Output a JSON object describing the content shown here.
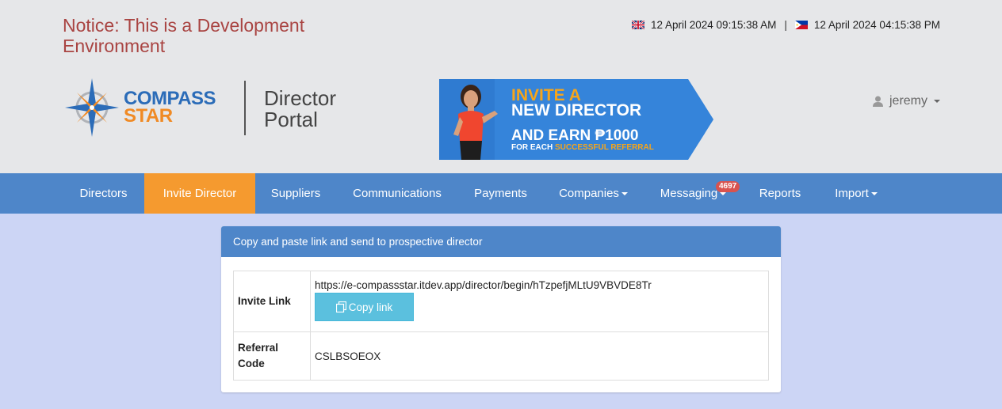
{
  "notice": "Notice: This is a Development Environment",
  "clock": {
    "uk_time": "12 April 2024 09:15:38 AM",
    "separator": "|",
    "ph_time": "12 April 2024 04:15:38 PM"
  },
  "logo": {
    "line1": "COMPASS",
    "line2": "STAR"
  },
  "portal": {
    "line1": "Director",
    "line2": "Portal"
  },
  "banner": {
    "line1": "INVITE A",
    "line2": "NEW DIRECTOR",
    "line3": "AND EARN ₱1000",
    "line4a": "FOR EACH",
    "line4b": "SUCCESSFUL REFERRAL"
  },
  "user": {
    "name": "jeremy",
    "icon": "user-icon"
  },
  "nav": {
    "directors": "Directors",
    "invite_director": "Invite Director",
    "suppliers": "Suppliers",
    "communications": "Communications",
    "payments": "Payments",
    "companies": "Companies",
    "messaging": "Messaging",
    "messaging_count": "4697",
    "reports": "Reports",
    "import": "Import"
  },
  "panel": {
    "heading": "Copy and paste link and send to prospective director",
    "invite_link_label": "Invite Link",
    "invite_link_value": "https://e-compassstar.itdev.app/director/begin/hTzpefjMLtU9VBVDE8Tr",
    "copy_button": "Copy link",
    "referral_label": "Referral Code",
    "referral_value": "CSLBSOEOX"
  },
  "colors": {
    "navbar": "#4e86c9",
    "active_tab": "#f59a2f",
    "notice": "#a94442",
    "copy_button": "#5bc0de",
    "badge": "#d9534f",
    "page_bg": "#ccd5f5"
  }
}
